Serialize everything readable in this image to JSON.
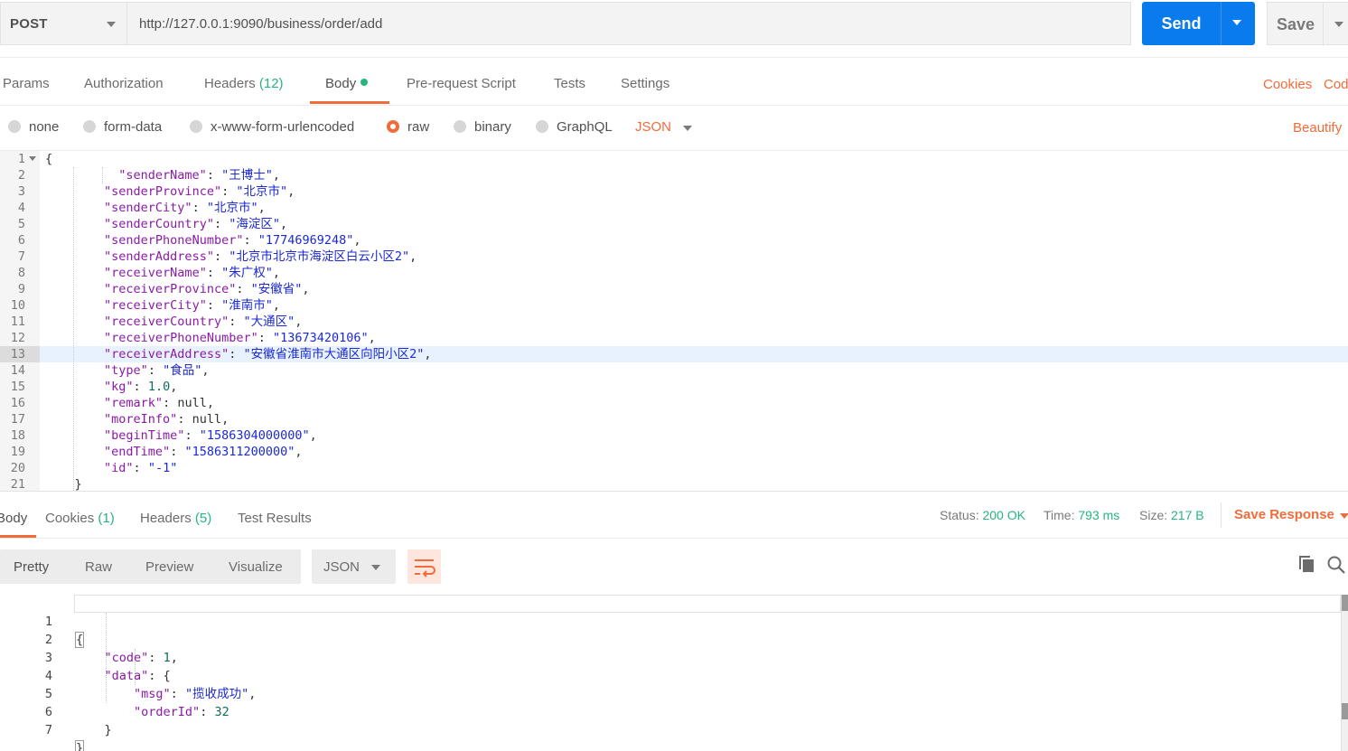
{
  "request": {
    "method": "POST",
    "url": "http://127.0.0.1:9090/business/order/add",
    "send_label": "Send",
    "save_label": "Save"
  },
  "request_tabs": [
    {
      "label": "Params"
    },
    {
      "label": "Authorization"
    },
    {
      "label": "Headers",
      "count": "(12)"
    },
    {
      "label": "Body"
    },
    {
      "label": "Pre-request Script"
    },
    {
      "label": "Tests"
    },
    {
      "label": "Settings"
    }
  ],
  "request_links": {
    "cookies": "Cookies",
    "code": "Cod"
  },
  "body_types": [
    "none",
    "form-data",
    "x-www-form-urlencoded",
    "raw",
    "binary",
    "GraphQL"
  ],
  "body_format": "JSON",
  "beautify_label": "Beautify",
  "request_body": {
    "line_numbers": [
      "1",
      "2",
      "3",
      "4",
      "5",
      "6",
      "7",
      "8",
      "9",
      "10",
      "11",
      "12",
      "13",
      "14",
      "15",
      "16",
      "17",
      "18",
      "19",
      "20",
      "21"
    ],
    "fields": [
      {
        "key": "\"senderName\"",
        "value": "\"王博士\""
      },
      {
        "key": "\"senderProvince\"",
        "value": "\"北京市\""
      },
      {
        "key": "\"senderCity\"",
        "value": "\"北京市\""
      },
      {
        "key": "\"senderCountry\"",
        "value": "\"海淀区\""
      },
      {
        "key": "\"senderPhoneNumber\"",
        "value": "\"17746969248\""
      },
      {
        "key": "\"senderAddress\"",
        "value": "\"北京市北京市海淀区白云小区2\""
      },
      {
        "key": "\"receiverName\"",
        "value": "\"朱广权\""
      },
      {
        "key": "\"receiverProvince\"",
        "value": "\"安徽省\""
      },
      {
        "key": "\"receiverCity\"",
        "value": "\"淮南市\""
      },
      {
        "key": "\"receiverCountry\"",
        "value": "\"大通区\""
      },
      {
        "key": "\"receiverPhoneNumber\"",
        "value": "\"13673420106\""
      },
      {
        "key": "\"receiverAddress\"",
        "value": "\"安徽省淮南市大通区向阳小区2\""
      },
      {
        "key": "\"type\"",
        "value": "\"食品\""
      },
      {
        "key": "\"kg\"",
        "value": "1.0"
      },
      {
        "key": "\"remark\"",
        "value": "null"
      },
      {
        "key": "\"moreInfo\"",
        "value": "null"
      },
      {
        "key": "\"beginTime\"",
        "value": "\"1586304000000\""
      },
      {
        "key": "\"endTime\"",
        "value": "\"1586311200000\""
      },
      {
        "key": "\"id\"",
        "value": "\"-1\""
      }
    ],
    "open_brace": "{",
    "close_brace": "}"
  },
  "response_tabs": [
    {
      "label": "Body"
    },
    {
      "label": "Cookies",
      "count": "(1)"
    },
    {
      "label": "Headers",
      "count": "(5)"
    },
    {
      "label": "Test Results"
    }
  ],
  "response_status": {
    "status_label": "Status:",
    "status_value": "200 OK",
    "time_label": "Time:",
    "time_value": "793 ms",
    "size_label": "Size:",
    "size_value": "217 B",
    "save_response": "Save Response"
  },
  "response_views": [
    "Pretty",
    "Raw",
    "Preview",
    "Visualize"
  ],
  "response_format": "JSON",
  "response_body": {
    "line_numbers": [
      "1",
      "2",
      "3",
      "4",
      "5",
      "6",
      "7"
    ],
    "code_key": "\"code\"",
    "code_value": "1",
    "data_key": "\"data\"",
    "msg_key": "\"msg\"",
    "msg_value": "\"揽收成功\"",
    "orderId_key": "\"orderId\"",
    "orderId_value": "32"
  },
  "icons": [
    "caret-down-icon",
    "wrap-lines-icon",
    "copy-icon",
    "search-icon"
  ],
  "colors": {
    "accent": "#f26b3a",
    "send": "#097bed",
    "success": "#26b47f"
  }
}
